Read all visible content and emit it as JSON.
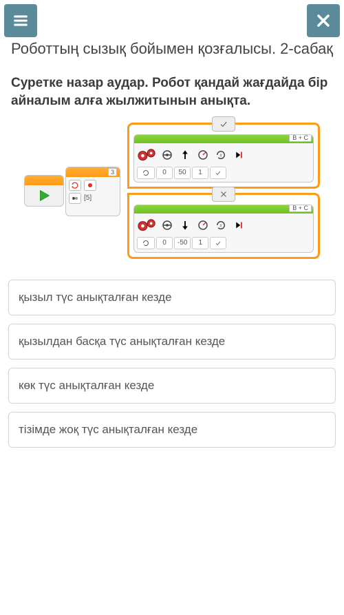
{
  "header": {
    "title": "Роботтың сызық бойымен қозғалысы. 2-сабақ"
  },
  "question": "Суретке назар аудар. Робот қандай жағдайда бір айналым алға жылжитынын анықта.",
  "program": {
    "loop": {
      "count_badge": "3",
      "iterations_label": "[5]"
    },
    "switch": {
      "true_branch": {
        "motor": {
          "ports": "B + C",
          "direction": "up",
          "params": {
            "power": "0",
            "rotations": "50",
            "value": "1"
          }
        }
      },
      "false_branch": {
        "motor": {
          "ports": "B + C",
          "direction": "down",
          "params": {
            "power": "0",
            "rotations": "-50",
            "value": "1"
          }
        }
      }
    }
  },
  "options": [
    "қызыл түс анықталған кезде",
    "қызылдан басқа түс анықталған кезде",
    "көк түс анықталған кезде",
    "тізімде жоқ түс анықталған кезде"
  ]
}
